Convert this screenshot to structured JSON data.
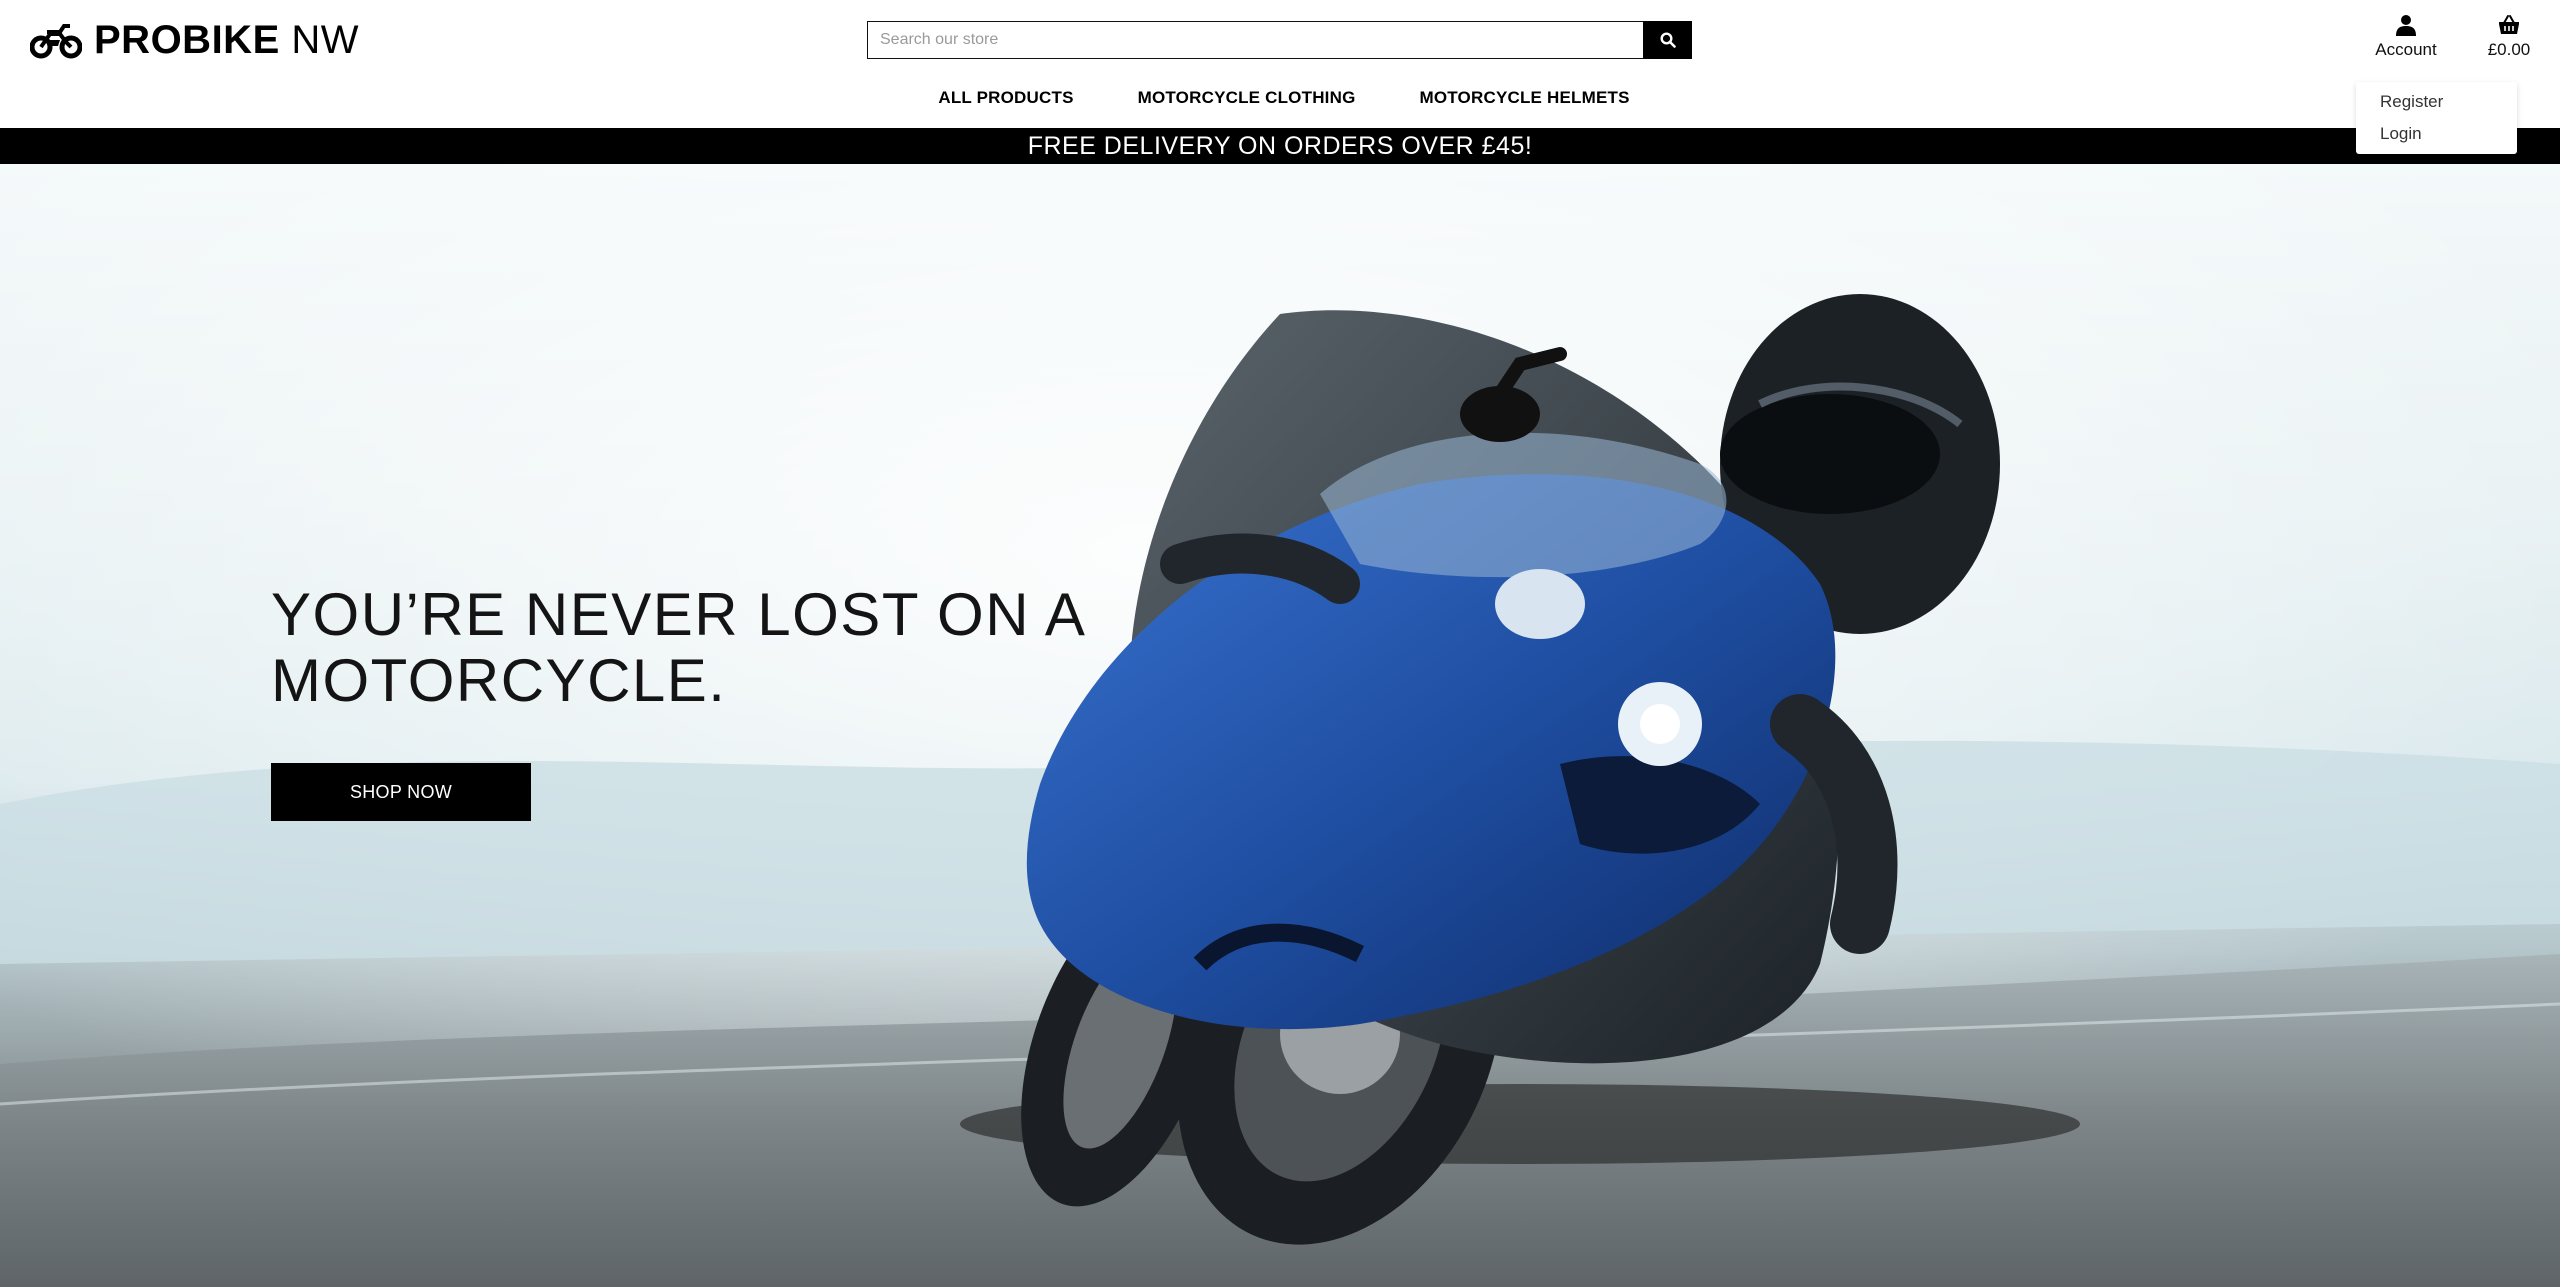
{
  "brand": {
    "name_bold": "PROBIKE",
    "name_light": "NW",
    "logo_icon": "motorcycle-icon"
  },
  "search": {
    "placeholder": "Search our store",
    "value": "",
    "button_icon": "search-icon"
  },
  "account": {
    "label": "Account",
    "icon": "user-icon",
    "menu": {
      "items": [
        "Register",
        "Login"
      ]
    }
  },
  "cart": {
    "total": "£0.00",
    "icon": "basket-icon"
  },
  "nav": {
    "items": [
      {
        "label": "ALL PRODUCTS"
      },
      {
        "label": "MOTORCYCLE CLOTHING"
      },
      {
        "label": "MOTORCYCLE HELMETS"
      }
    ]
  },
  "promo": {
    "text": "FREE DELIVERY ON ORDERS OVER £45!"
  },
  "hero": {
    "headline_line1": "YOU’RE NEVER LOST ON A",
    "headline_line2": "MOTORCYCLE.",
    "cta_label": "SHOP NOW",
    "image": "motorcyclist-leaning-into-corner"
  },
  "colors": {
    "text": "#000000",
    "background": "#ffffff",
    "promo_bar": "#000000",
    "button": "#000000",
    "bike_blue": "#1f4fa3"
  }
}
